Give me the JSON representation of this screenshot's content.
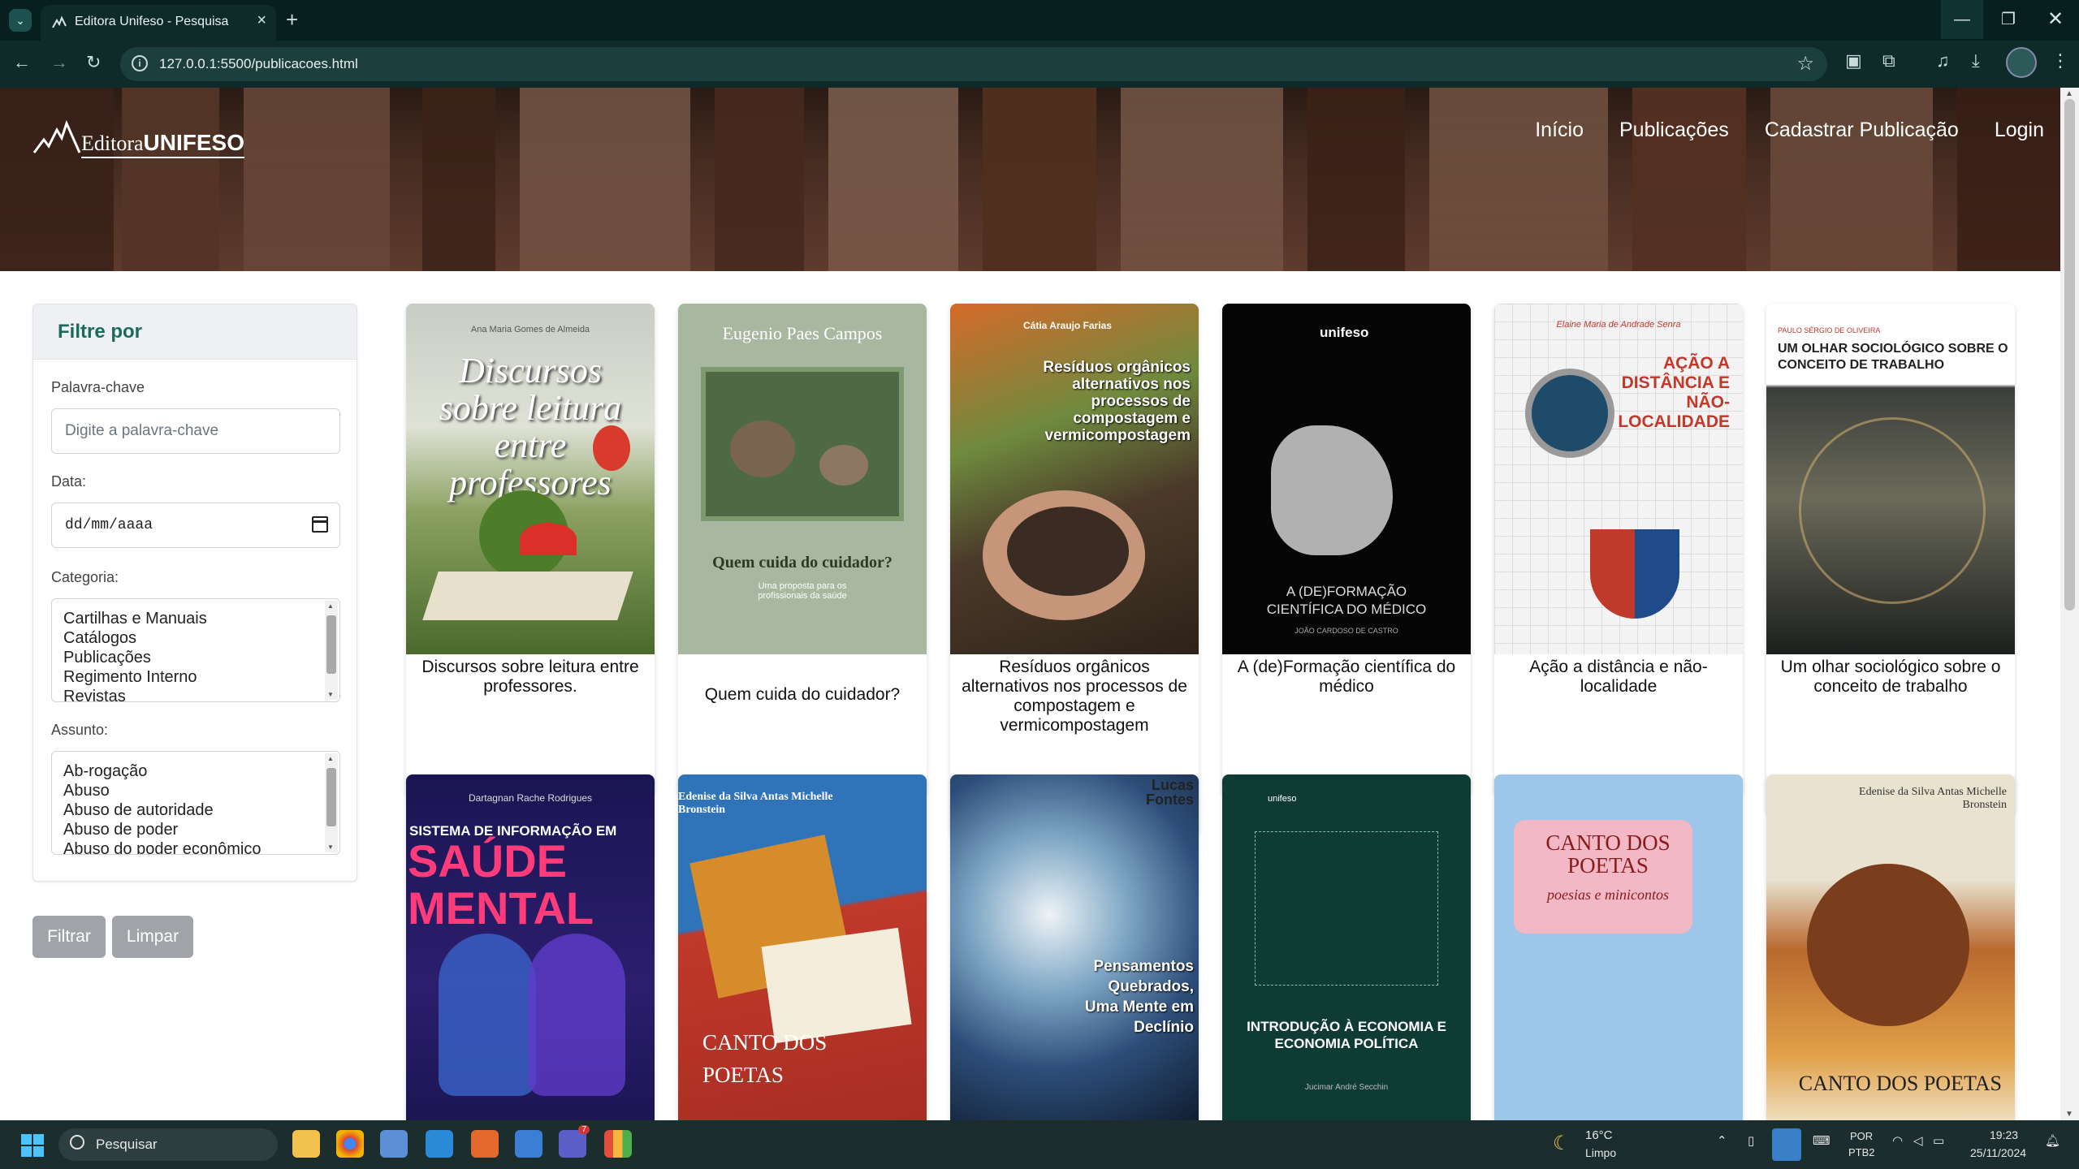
{
  "browser": {
    "tab_title": "Editora Unifeso - Pesquisa",
    "url": "127.0.0.1:5500/publicacoes.html"
  },
  "site": {
    "logo_prefix": "Editora",
    "logo_brand": "UNIFESO",
    "nav": [
      "Início",
      "Publicações",
      "Cadastrar Publicação",
      "Login"
    ]
  },
  "filter": {
    "title": "Filtre por",
    "keyword_label": "Palavra-chave",
    "keyword_placeholder": "Digite a palavra-chave",
    "date_label": "Data:",
    "date_placeholder": "dd/mm/aaaa",
    "category_label": "Categoria:",
    "categories": [
      "Cartilhas e Manuais",
      "Catálogos",
      "Publicações",
      "Regimento Interno",
      "Revistas"
    ],
    "subject_label": "Assunto:",
    "subjects": [
      "Ab-rogação",
      "Abuso",
      "Abuso de autoridade",
      "Abuso de poder",
      "Abuso do poder econômico"
    ],
    "filter_button": "Filtrar",
    "clear_button": "Limpar"
  },
  "publications": [
    {
      "title": "Discursos sobre leitura entre professores.",
      "cover_author": "Ana Maria Gomes de Almeida",
      "cover_title": "Discursos sobre leitura entre professores"
    },
    {
      "title": "Quem cuida do cuidador?",
      "cover_author": "Eugenio Paes Campos",
      "cover_title": "Quem cuida do cuidador?",
      "cover_subtitle": "Uma proposta para os profissionais da saúde"
    },
    {
      "title": "Resíduos orgânicos alternativos nos processos de compostagem e vermicompostagem",
      "cover_author": "Cátia Araujo Farias",
      "cover_title": "Resíduos orgânicos alternativos nos processos de compostagem e vermicompostagem"
    },
    {
      "title": "A (de)Formação científica do médico",
      "cover_author": "JOÃO CARDOSO DE CASTRO",
      "cover_title": "A (DE)FORMAÇÃO CIENTÍFICA DO MÉDICO"
    },
    {
      "title": "Ação a distância e não-localidade",
      "cover_author": "Elaine Maria de Andrade Senra",
      "cover_title": "AÇÃO A DISTÂNCIA E NÃO-LOCALIDADE"
    },
    {
      "title": "Um olhar sociológico sobre o conceito de trabalho",
      "cover_author": "PAULO SÉRGIO DE OLIVEIRA",
      "cover_title": "UM OLHAR SOCIOLÓGICO SOBRE O CONCEITO DE TRABALHO"
    },
    {
      "title": "",
      "cover_author": "Dartagnan Rache Rodrigues",
      "cover_title": "SISTEMA DE INFORMAÇÃO EM",
      "cover_big": "SAÚDE MENTAL"
    },
    {
      "title": "",
      "cover_author": "Edenise da Silva Antas Michelle Bronstein",
      "cover_title": "CANTO DOS POETAS"
    },
    {
      "title": "",
      "cover_author": "Lucas Fontes",
      "cover_title": "Pensamentos Quebrados, Uma Mente em Declínio"
    },
    {
      "title": "",
      "cover_author": "Jucimar André Secchin",
      "cover_title": "INTRODUÇÃO À ECONOMIA E ECONOMIA POLÍTICA"
    },
    {
      "title": "",
      "cover_author": "",
      "cover_title": "CANTO DOS POETAS",
      "cover_subtitle": "poesias e minicontos"
    },
    {
      "title": "",
      "cover_author": "Edenise da Silva Antas Michelle Bronstein",
      "cover_title": "CANTO DOS POETAS"
    }
  ],
  "taskbar": {
    "search_placeholder": "Pesquisar",
    "weather_temp": "16°C",
    "weather_desc": "Limpo",
    "lang1": "POR",
    "lang2": "PTB2",
    "time": "19:23",
    "date": "25/11/2024",
    "teams_badge": "7"
  },
  "colors": {
    "accent": "#1a6b5c",
    "chrome": "#0e2b2a",
    "button": "#a0a4a8"
  }
}
